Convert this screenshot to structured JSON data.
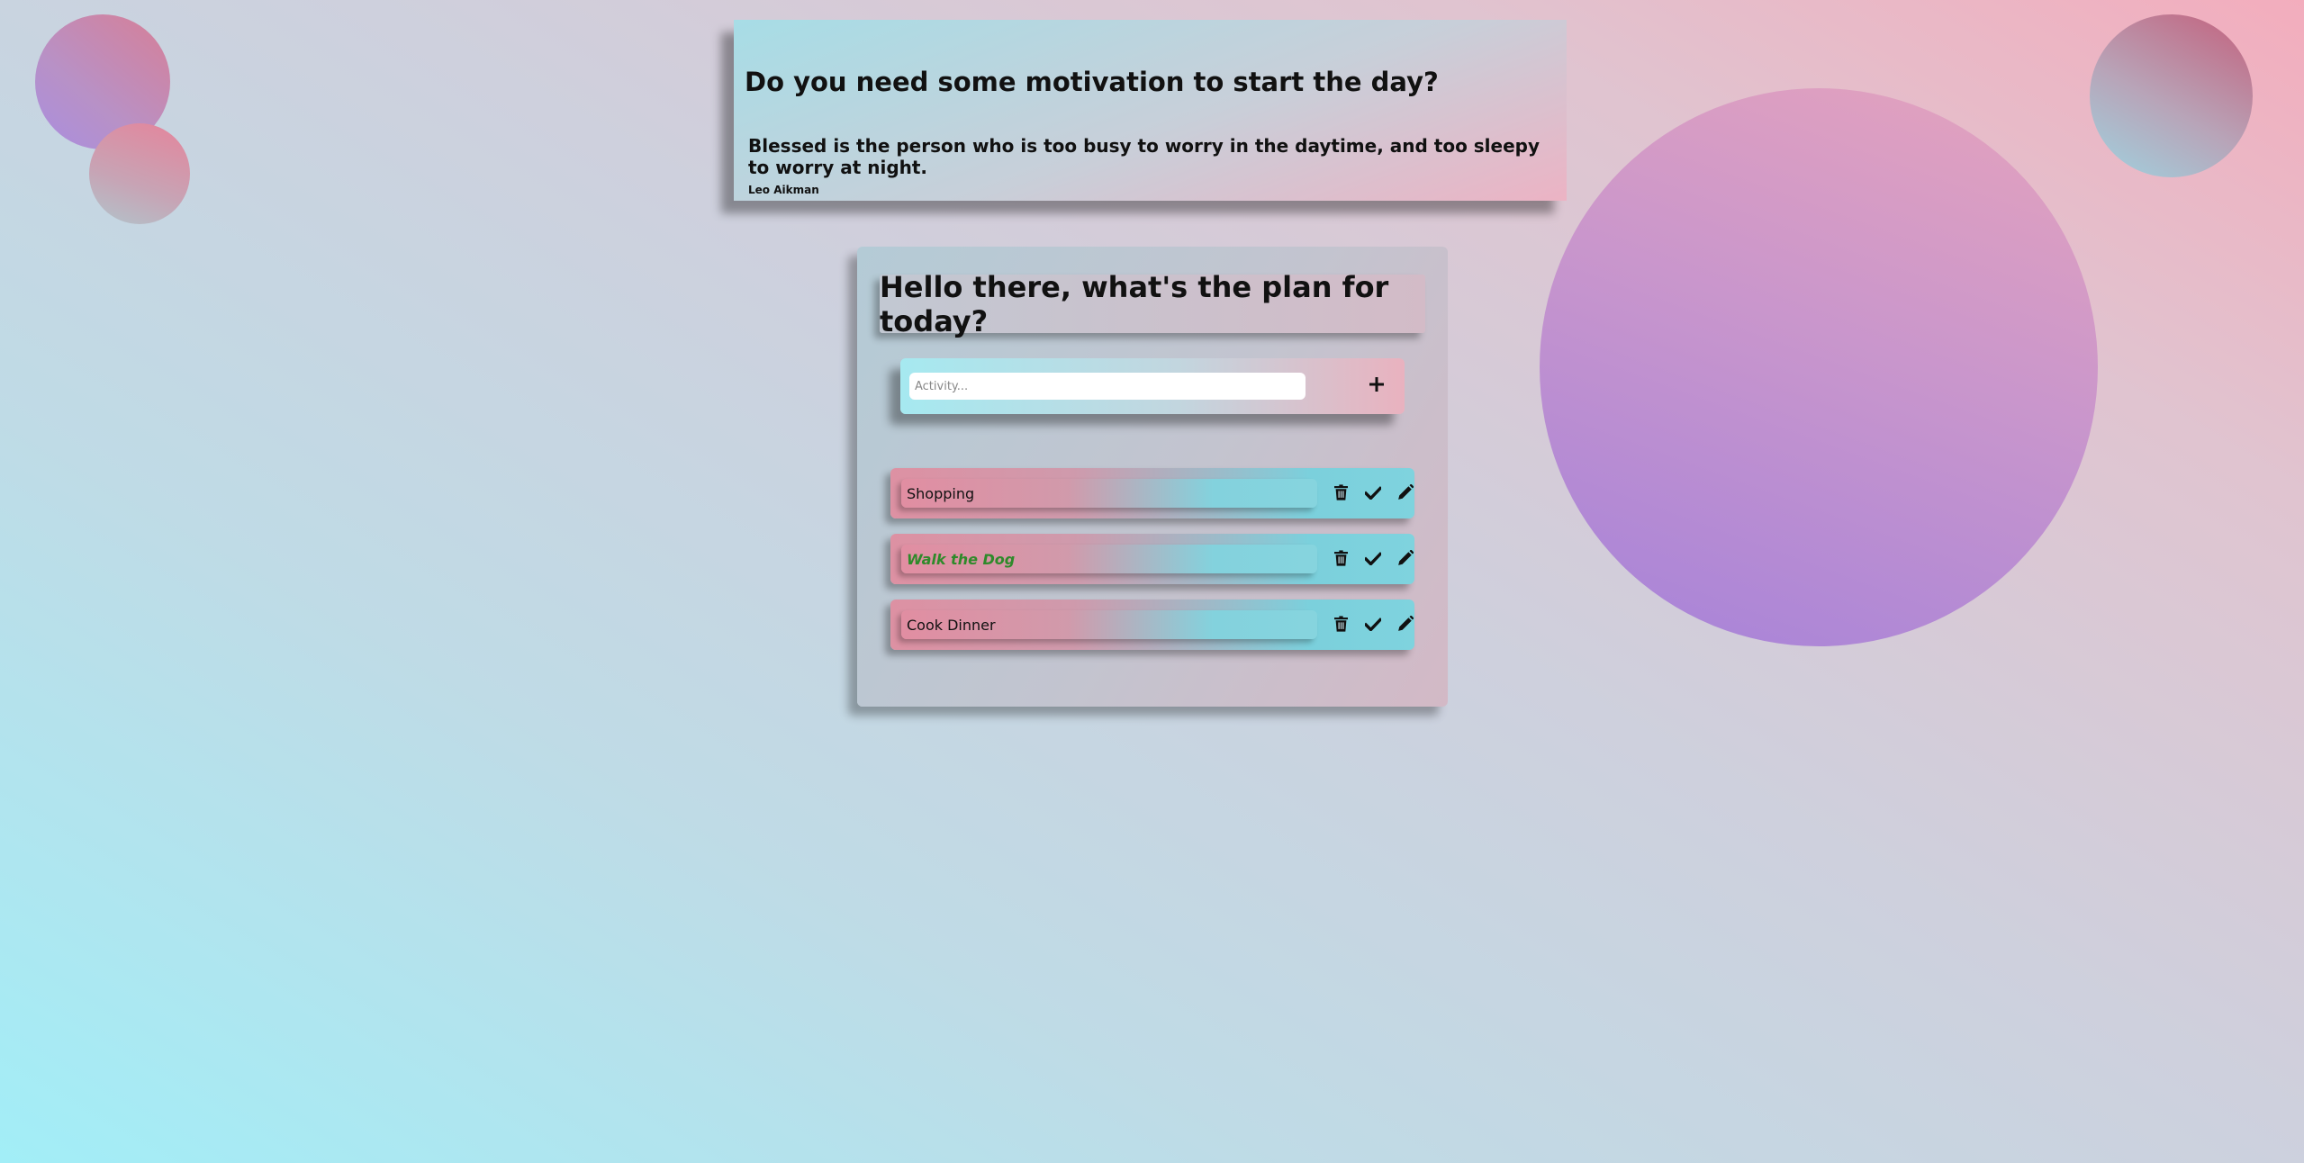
{
  "motivation": {
    "title": "Do you need some motivation to start the day?",
    "quote": "Blessed is the person who is too busy to worry in the daytime, and too sleepy to worry at night.",
    "author": "Leo Aikman"
  },
  "todo": {
    "header": "Hello there, what's the plan for today?",
    "input_placeholder": "Activity...",
    "input_value": "",
    "add_icon": "plus-icon",
    "items": [
      {
        "label": "Shopping",
        "completed": false
      },
      {
        "label": "Walk the Dog",
        "completed": true
      },
      {
        "label": "Cook Dinner",
        "completed": false
      }
    ],
    "item_actions": [
      "trash-icon",
      "check-icon",
      "pencil-icon"
    ]
  },
  "colors": {
    "completed_text": "#2e8a2a"
  }
}
